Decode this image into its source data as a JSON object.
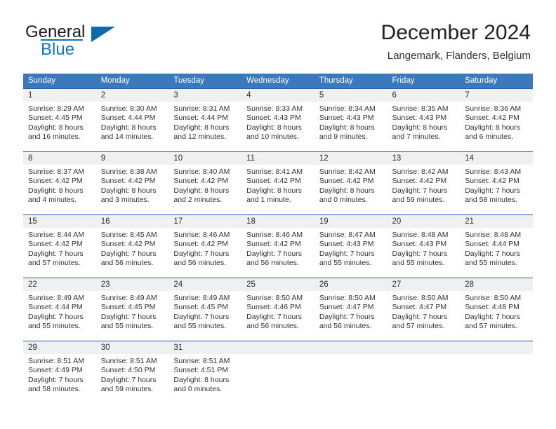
{
  "brand": {
    "name_part1": "General",
    "name_part2": "Blue",
    "flag_icon": "blue-triangle-flag-icon"
  },
  "header": {
    "month_title": "December 2024",
    "location": "Langemark, Flanders, Belgium"
  },
  "colors": {
    "header_blue": "#3b78bc",
    "row_border_blue": "#1f5fa8",
    "daynum_band": "#f0f0f0",
    "brand_blue": "#1273ba",
    "text": "#333333"
  },
  "weekdays": [
    "Sunday",
    "Monday",
    "Tuesday",
    "Wednesday",
    "Thursday",
    "Friday",
    "Saturday"
  ],
  "weeks": [
    [
      {
        "day": "1",
        "sunrise": "Sunrise: 8:29 AM",
        "sunset": "Sunset: 4:45 PM",
        "daylight1": "Daylight: 8 hours",
        "daylight2": "and 16 minutes."
      },
      {
        "day": "2",
        "sunrise": "Sunrise: 8:30 AM",
        "sunset": "Sunset: 4:44 PM",
        "daylight1": "Daylight: 8 hours",
        "daylight2": "and 14 minutes."
      },
      {
        "day": "3",
        "sunrise": "Sunrise: 8:31 AM",
        "sunset": "Sunset: 4:44 PM",
        "daylight1": "Daylight: 8 hours",
        "daylight2": "and 12 minutes."
      },
      {
        "day": "4",
        "sunrise": "Sunrise: 8:33 AM",
        "sunset": "Sunset: 4:43 PM",
        "daylight1": "Daylight: 8 hours",
        "daylight2": "and 10 minutes."
      },
      {
        "day": "5",
        "sunrise": "Sunrise: 8:34 AM",
        "sunset": "Sunset: 4:43 PM",
        "daylight1": "Daylight: 8 hours",
        "daylight2": "and 9 minutes."
      },
      {
        "day": "6",
        "sunrise": "Sunrise: 8:35 AM",
        "sunset": "Sunset: 4:43 PM",
        "daylight1": "Daylight: 8 hours",
        "daylight2": "and 7 minutes."
      },
      {
        "day": "7",
        "sunrise": "Sunrise: 8:36 AM",
        "sunset": "Sunset: 4:42 PM",
        "daylight1": "Daylight: 8 hours",
        "daylight2": "and 6 minutes."
      }
    ],
    [
      {
        "day": "8",
        "sunrise": "Sunrise: 8:37 AM",
        "sunset": "Sunset: 4:42 PM",
        "daylight1": "Daylight: 8 hours",
        "daylight2": "and 4 minutes."
      },
      {
        "day": "9",
        "sunrise": "Sunrise: 8:38 AM",
        "sunset": "Sunset: 4:42 PM",
        "daylight1": "Daylight: 8 hours",
        "daylight2": "and 3 minutes."
      },
      {
        "day": "10",
        "sunrise": "Sunrise: 8:40 AM",
        "sunset": "Sunset: 4:42 PM",
        "daylight1": "Daylight: 8 hours",
        "daylight2": "and 2 minutes."
      },
      {
        "day": "11",
        "sunrise": "Sunrise: 8:41 AM",
        "sunset": "Sunset: 4:42 PM",
        "daylight1": "Daylight: 8 hours",
        "daylight2": "and 1 minute."
      },
      {
        "day": "12",
        "sunrise": "Sunrise: 8:42 AM",
        "sunset": "Sunset: 4:42 PM",
        "daylight1": "Daylight: 8 hours",
        "daylight2": "and 0 minutes."
      },
      {
        "day": "13",
        "sunrise": "Sunrise: 8:42 AM",
        "sunset": "Sunset: 4:42 PM",
        "daylight1": "Daylight: 7 hours",
        "daylight2": "and 59 minutes."
      },
      {
        "day": "14",
        "sunrise": "Sunrise: 8:43 AM",
        "sunset": "Sunset: 4:42 PM",
        "daylight1": "Daylight: 7 hours",
        "daylight2": "and 58 minutes."
      }
    ],
    [
      {
        "day": "15",
        "sunrise": "Sunrise: 8:44 AM",
        "sunset": "Sunset: 4:42 PM",
        "daylight1": "Daylight: 7 hours",
        "daylight2": "and 57 minutes."
      },
      {
        "day": "16",
        "sunrise": "Sunrise: 8:45 AM",
        "sunset": "Sunset: 4:42 PM",
        "daylight1": "Daylight: 7 hours",
        "daylight2": "and 56 minutes."
      },
      {
        "day": "17",
        "sunrise": "Sunrise: 8:46 AM",
        "sunset": "Sunset: 4:42 PM",
        "daylight1": "Daylight: 7 hours",
        "daylight2": "and 56 minutes."
      },
      {
        "day": "18",
        "sunrise": "Sunrise: 8:46 AM",
        "sunset": "Sunset: 4:42 PM",
        "daylight1": "Daylight: 7 hours",
        "daylight2": "and 56 minutes."
      },
      {
        "day": "19",
        "sunrise": "Sunrise: 8:47 AM",
        "sunset": "Sunset: 4:43 PM",
        "daylight1": "Daylight: 7 hours",
        "daylight2": "and 55 minutes."
      },
      {
        "day": "20",
        "sunrise": "Sunrise: 8:48 AM",
        "sunset": "Sunset: 4:43 PM",
        "daylight1": "Daylight: 7 hours",
        "daylight2": "and 55 minutes."
      },
      {
        "day": "21",
        "sunrise": "Sunrise: 8:48 AM",
        "sunset": "Sunset: 4:44 PM",
        "daylight1": "Daylight: 7 hours",
        "daylight2": "and 55 minutes."
      }
    ],
    [
      {
        "day": "22",
        "sunrise": "Sunrise: 8:49 AM",
        "sunset": "Sunset: 4:44 PM",
        "daylight1": "Daylight: 7 hours",
        "daylight2": "and 55 minutes."
      },
      {
        "day": "23",
        "sunrise": "Sunrise: 8:49 AM",
        "sunset": "Sunset: 4:45 PM",
        "daylight1": "Daylight: 7 hours",
        "daylight2": "and 55 minutes."
      },
      {
        "day": "24",
        "sunrise": "Sunrise: 8:49 AM",
        "sunset": "Sunset: 4:45 PM",
        "daylight1": "Daylight: 7 hours",
        "daylight2": "and 55 minutes."
      },
      {
        "day": "25",
        "sunrise": "Sunrise: 8:50 AM",
        "sunset": "Sunset: 4:46 PM",
        "daylight1": "Daylight: 7 hours",
        "daylight2": "and 56 minutes."
      },
      {
        "day": "26",
        "sunrise": "Sunrise: 8:50 AM",
        "sunset": "Sunset: 4:47 PM",
        "daylight1": "Daylight: 7 hours",
        "daylight2": "and 56 minutes."
      },
      {
        "day": "27",
        "sunrise": "Sunrise: 8:50 AM",
        "sunset": "Sunset: 4:47 PM",
        "daylight1": "Daylight: 7 hours",
        "daylight2": "and 57 minutes."
      },
      {
        "day": "28",
        "sunrise": "Sunrise: 8:50 AM",
        "sunset": "Sunset: 4:48 PM",
        "daylight1": "Daylight: 7 hours",
        "daylight2": "and 57 minutes."
      }
    ],
    [
      {
        "day": "29",
        "sunrise": "Sunrise: 8:51 AM",
        "sunset": "Sunset: 4:49 PM",
        "daylight1": "Daylight: 7 hours",
        "daylight2": "and 58 minutes."
      },
      {
        "day": "30",
        "sunrise": "Sunrise: 8:51 AM",
        "sunset": "Sunset: 4:50 PM",
        "daylight1": "Daylight: 7 hours",
        "daylight2": "and 59 minutes."
      },
      {
        "day": "31",
        "sunrise": "Sunrise: 8:51 AM",
        "sunset": "Sunset: 4:51 PM",
        "daylight1": "Daylight: 8 hours",
        "daylight2": "and 0 minutes."
      },
      {
        "day": "",
        "sunrise": "",
        "sunset": "",
        "daylight1": "",
        "daylight2": ""
      },
      {
        "day": "",
        "sunrise": "",
        "sunset": "",
        "daylight1": "",
        "daylight2": ""
      },
      {
        "day": "",
        "sunrise": "",
        "sunset": "",
        "daylight1": "",
        "daylight2": ""
      },
      {
        "day": "",
        "sunrise": "",
        "sunset": "",
        "daylight1": "",
        "daylight2": ""
      }
    ]
  ]
}
